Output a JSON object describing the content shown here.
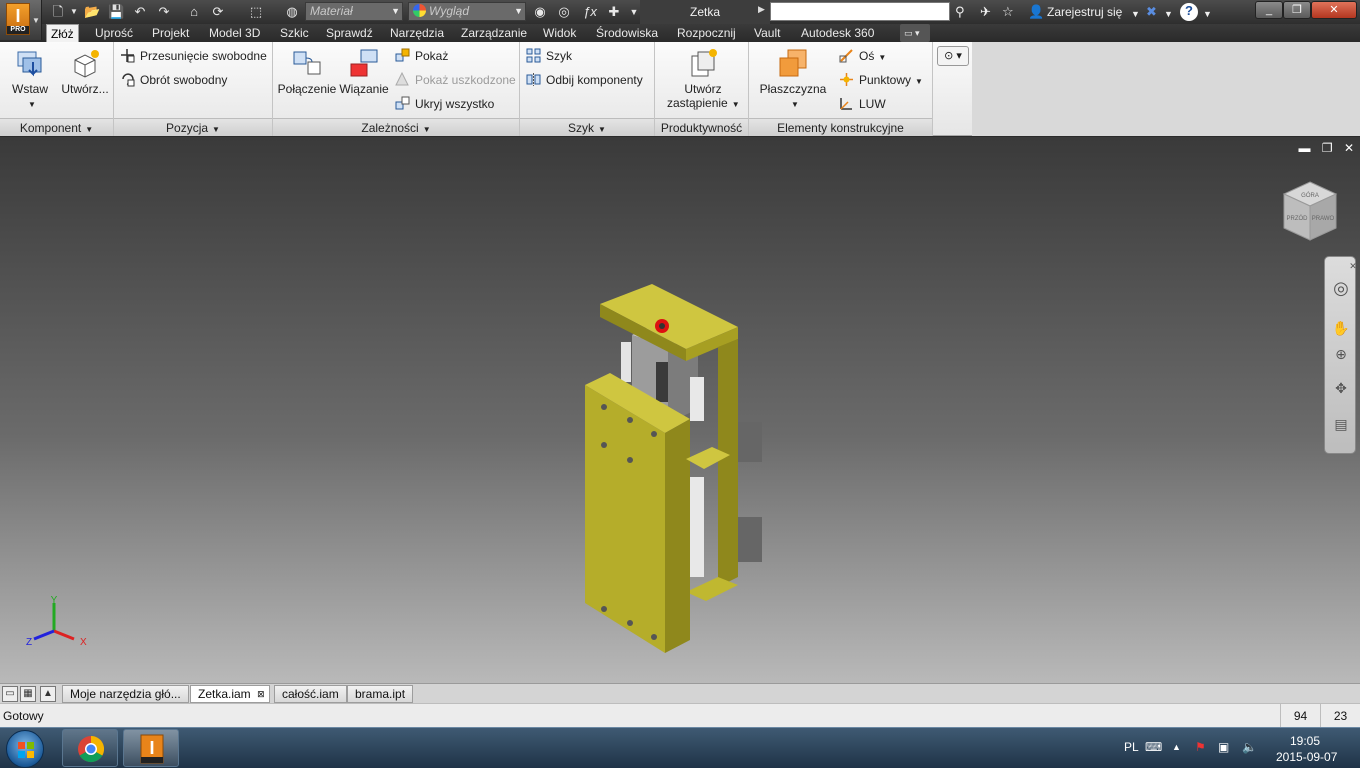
{
  "app": {
    "logo_letter": "I",
    "logo_badge": "PRO",
    "document_title": "Zetka",
    "material_placeholder": "Materiał",
    "appearance_placeholder": "Wygląd",
    "register_label": "Zarejestruj się",
    "help_label": "?"
  },
  "tabs": [
    "Złóż",
    "Uprość",
    "Projekt",
    "Model 3D",
    "Szkic",
    "Sprawdź",
    "Narzędzia",
    "Zarządzanie",
    "Widok",
    "Środowiska",
    "Rozpocznij",
    "Vault",
    "Autodesk 360"
  ],
  "ribbon": {
    "komponent": {
      "title": "Komponent",
      "insert": "Wstaw",
      "create": "Utwórz..."
    },
    "pozycja": {
      "title": "Pozycja",
      "free_move": "Przesunięcie swobodne",
      "free_rotate": "Obrót swobodny"
    },
    "zaleznosci": {
      "title": "Zależności",
      "joint": "Połączenie",
      "constrain": "Wiązanie",
      "show": "Pokaż",
      "show_sick": "Pokaż uszkodzone",
      "hide_all": "Ukryj wszystko"
    },
    "szyk": {
      "title": "Szyk",
      "pattern": "Szyk",
      "mirror": "Odbij komponenty"
    },
    "produktywnosc": {
      "title": "Produktywność",
      "substitute_line1": "Utwórz",
      "substitute_line2": "zastąpienie"
    },
    "elementy": {
      "title": "Elementy konstrukcyjne",
      "plane": "Płaszczyzna",
      "axis": "Oś",
      "point": "Punktowy",
      "ucs": "LUW"
    }
  },
  "viewcube": {
    "front": "PRZÓD",
    "right": "PRAWO",
    "top": "GÓRA"
  },
  "triad": {
    "x": "X",
    "y": "Y",
    "z": "Z"
  },
  "doc_tabs": [
    "Moje narzędzia głó...",
    "Zetka.iam",
    "całość.iam",
    "brama.ipt"
  ],
  "status": {
    "text": "Gotowy",
    "count1": "94",
    "count2": "23"
  },
  "taskbar": {
    "lang": "PL",
    "time": "19:05",
    "date": "2015-09-07"
  },
  "colors": {
    "model_yellow": "#b5ad2a",
    "accent_orange": "#e8841a",
    "viewport_top": "#3a3a3a",
    "viewport_bottom": "#b9b9b9"
  }
}
